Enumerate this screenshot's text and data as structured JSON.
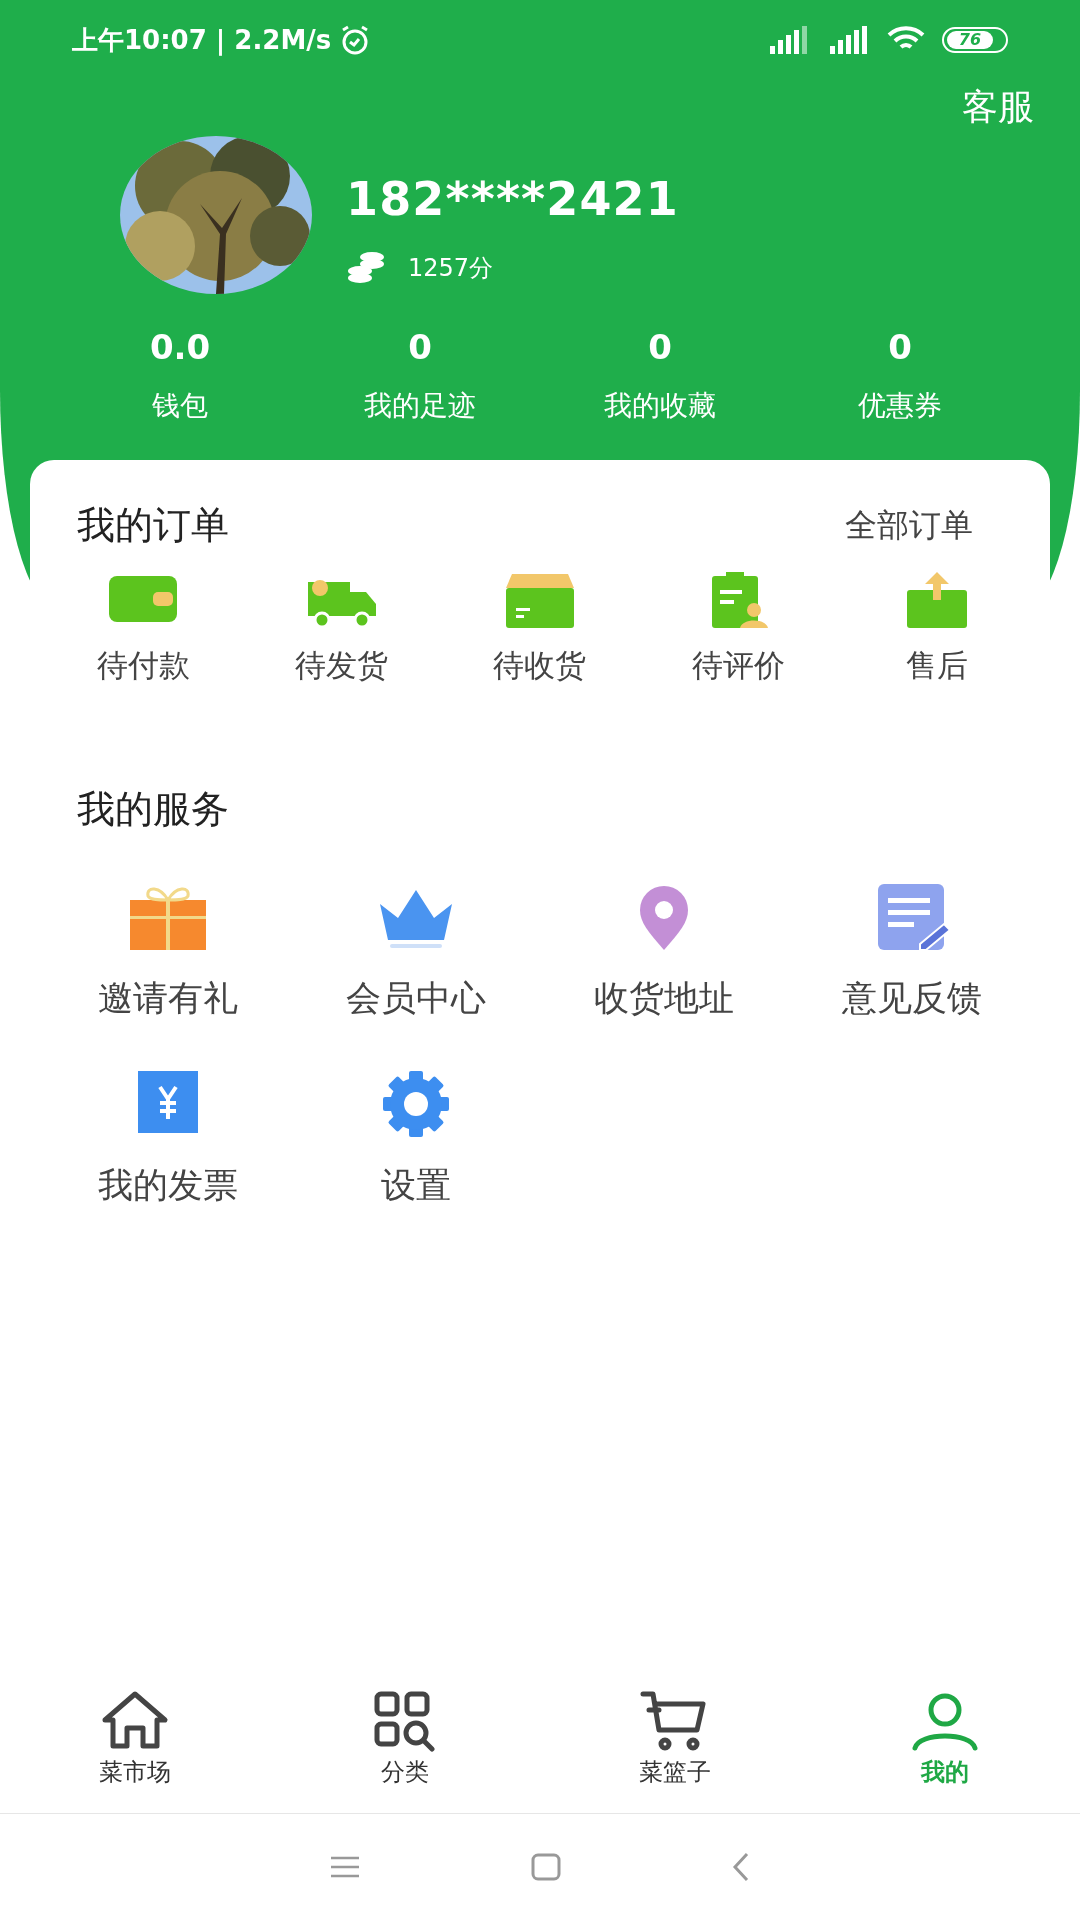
{
  "status_bar": {
    "time": "上午10:07 | 2.2M/s",
    "battery": "76"
  },
  "header": {
    "service_link": "客服",
    "phone": "182****2421",
    "points": "1257分"
  },
  "stats": [
    {
      "value": "0.0",
      "label": "钱包"
    },
    {
      "value": "0",
      "label": "我的足迹"
    },
    {
      "value": "0",
      "label": "我的收藏"
    },
    {
      "value": "0",
      "label": "优惠券"
    }
  ],
  "orders": {
    "title": "我的订单",
    "all_link": "全部订单",
    "items": [
      {
        "kind": "wallet",
        "label": "待付款"
      },
      {
        "kind": "truck",
        "label": "待发货"
      },
      {
        "kind": "box",
        "label": "待收货"
      },
      {
        "kind": "review",
        "label": "待评价"
      },
      {
        "kind": "aftersale",
        "label": "售后"
      }
    ]
  },
  "services": {
    "title": "我的服务",
    "items": [
      {
        "kind": "gift",
        "label": "邀请有礼"
      },
      {
        "kind": "crown",
        "label": "会员中心"
      },
      {
        "kind": "pin",
        "label": "收货地址"
      },
      {
        "kind": "note",
        "label": "意见反馈"
      },
      {
        "kind": "invoice",
        "label": "我的发票"
      },
      {
        "kind": "gear",
        "label": "设置"
      }
    ]
  },
  "tabs": [
    {
      "kind": "home",
      "label": "菜市场",
      "selected": false
    },
    {
      "kind": "grid",
      "label": "分类",
      "selected": false
    },
    {
      "kind": "cart",
      "label": "菜篮子",
      "selected": false
    },
    {
      "kind": "user",
      "label": "我的",
      "selected": true
    }
  ]
}
